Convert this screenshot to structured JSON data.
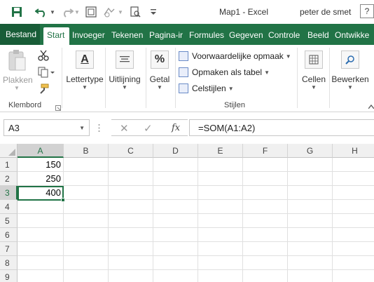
{
  "window": {
    "title": "Map1 - Excel",
    "user": "peter de smet",
    "help_label": "?"
  },
  "quick_access": {
    "save_icon": "save-icon",
    "undo_icon": "undo-icon",
    "redo_icon": "redo-icon",
    "customize_icon": "chevron-down-icon"
  },
  "tabs": [
    {
      "label": "Bestand"
    },
    {
      "label": "Start"
    },
    {
      "label": "Invoeger"
    },
    {
      "label": "Tekenen"
    },
    {
      "label": "Pagina-ir"
    },
    {
      "label": "Formules"
    },
    {
      "label": "Gegeven"
    },
    {
      "label": "Controle"
    },
    {
      "label": "Beeld"
    },
    {
      "label": "Ontwikke"
    }
  ],
  "ribbon": {
    "clipboard": {
      "paste_label": "Plakken",
      "group_label": "Klembord"
    },
    "font": {
      "label": "Lettertype"
    },
    "alignment": {
      "label": "Uitlijning"
    },
    "number": {
      "label": "Getal",
      "icon_glyph": "%"
    },
    "styles": {
      "conditional": "Voorwaardelijke opmaak",
      "format_table": "Opmaken als tabel",
      "cell_styles": "Celstijlen",
      "group_label": "Stijlen"
    },
    "cells": {
      "label": "Cellen"
    },
    "editing": {
      "label": "Bewerken"
    }
  },
  "formula_bar": {
    "name_box": "A3",
    "fx": "fx",
    "formula": "=SOM(A1:A2)"
  },
  "grid": {
    "columns": [
      "A",
      "B",
      "C",
      "D",
      "E",
      "F",
      "G",
      "H"
    ],
    "rows": [
      "1",
      "2",
      "3",
      "4",
      "5",
      "6",
      "7",
      "8",
      "9"
    ],
    "cells": {
      "A1": "150",
      "A2": "250",
      "A3": "400"
    },
    "selected_cell": "A3"
  },
  "colors": {
    "accent": "#217346",
    "tab_bar": "#217346"
  }
}
